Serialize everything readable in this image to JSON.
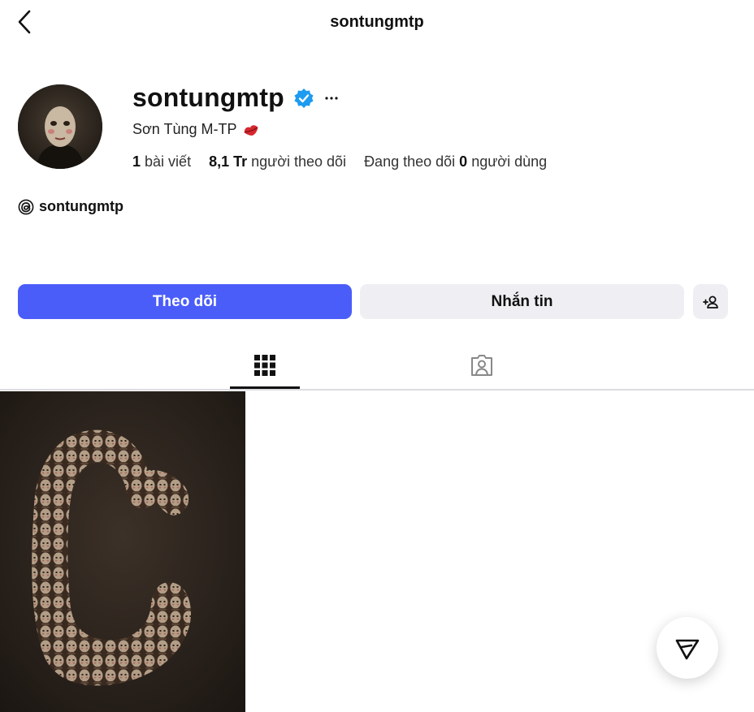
{
  "header": {
    "title": "sontungmtp"
  },
  "profile": {
    "username": "sontungmtp",
    "full_name": "Sơn Tùng M-TP",
    "stats": {
      "posts_count": "1",
      "posts_label": "bài viết",
      "followers_count": "8,1 Tr",
      "followers_label": "người theo dõi",
      "following_prefix": "Đang theo dõi",
      "following_count": "0",
      "following_suffix": "người dùng"
    },
    "threads_handle": "sontungmtp"
  },
  "actions": {
    "follow_label": "Theo dõi",
    "message_label": "Nhắn tin"
  },
  "tabs": [
    {
      "id": "posts",
      "icon": "grid-icon",
      "active": true
    },
    {
      "id": "tagged",
      "icon": "tagged-icon",
      "active": false
    }
  ],
  "posts": [
    {
      "icon": "image",
      "description_hidden": true
    }
  ],
  "icons": {
    "back": "back-icon",
    "verified": "verified-badge-icon",
    "more": "more-icon",
    "threads": "threads-icon",
    "add_friend": "add-user-icon",
    "send": "send-icon",
    "emoji": "lips-icon"
  },
  "colors": {
    "primary": "#4a5df9",
    "secondary_button": "#efeff3",
    "verified": "#1d9bf0",
    "text": "#111111"
  }
}
